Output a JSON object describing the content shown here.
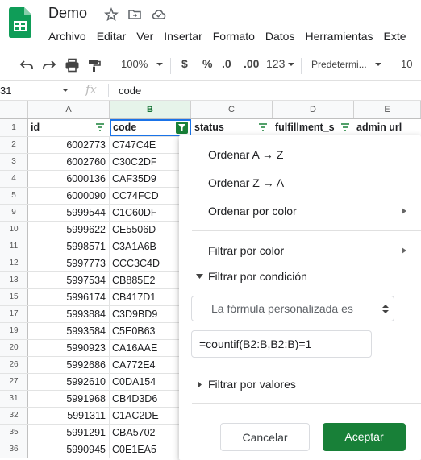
{
  "doc_title": "Demo",
  "menu": [
    "Archivo",
    "Editar",
    "Ver",
    "Insertar",
    "Formato",
    "Datos",
    "Herramientas",
    "Exte"
  ],
  "toolbar": {
    "zoom": "100%",
    "currency": "$",
    "percent": "%",
    "dec_less": ".0",
    "dec_more": ".00",
    "format_more": "123",
    "font": "Predetermi...",
    "font_size": "10"
  },
  "formula_bar": {
    "cell_ref": "31",
    "fx": "fx",
    "content": "code"
  },
  "columns": [
    "A",
    "B",
    "C",
    "D",
    "E"
  ],
  "header_row": {
    "row_number": "1",
    "cells": [
      "id",
      "code",
      "status",
      "fulfillment_s",
      "admin url"
    ]
  },
  "rows": [
    {
      "n": "2",
      "id": "6002773",
      "code": "C747C4E"
    },
    {
      "n": "3",
      "id": "6002760",
      "code": "C30C2DF"
    },
    {
      "n": "4",
      "id": "6000136",
      "code": "CAF35D9"
    },
    {
      "n": "5",
      "id": "6000090",
      "code": "CC74FCD"
    },
    {
      "n": "9",
      "id": "5999544",
      "code": "C1C60DF"
    },
    {
      "n": "10",
      "id": "5999622",
      "code": "CE5506D"
    },
    {
      "n": "11",
      "id": "5998571",
      "code": "C3A1A6B"
    },
    {
      "n": "12",
      "id": "5997773",
      "code": "CCC3C4D"
    },
    {
      "n": "13",
      "id": "5997534",
      "code": "CB885E2"
    },
    {
      "n": "15",
      "id": "5996174",
      "code": "CB417D1"
    },
    {
      "n": "17",
      "id": "5993884",
      "code": "C3D9BD9"
    },
    {
      "n": "19",
      "id": "5993584",
      "code": "C5E0B63"
    },
    {
      "n": "20",
      "id": "5990923",
      "code": "CA16AAE"
    },
    {
      "n": "26",
      "id": "5992686",
      "code": "CA772E4"
    },
    {
      "n": "27",
      "id": "5992610",
      "code": "C0DA154"
    },
    {
      "n": "31",
      "id": "5991968",
      "code": "CB4D3D6"
    },
    {
      "n": "32",
      "id": "5991311",
      "code": "C1AC2DE"
    },
    {
      "n": "35",
      "id": "5991291",
      "code": "CBA5702"
    },
    {
      "n": "36",
      "id": "5990945",
      "code": "C0E1EA5"
    }
  ],
  "filter_menu": {
    "sort_az": "Ordenar A → Z",
    "sort_za": "Ordenar Z → A",
    "sort_color": "Ordenar por color",
    "filter_color": "Filtrar por color",
    "filter_condition": "Filtrar por condición",
    "condition_select": "La fórmula personalizada es",
    "formula_value": "=countif(B2:B,B2:B)=1",
    "filter_values": "Filtrar por valores",
    "cancel": "Cancelar",
    "ok": "Aceptar"
  },
  "colors": {
    "accent_green": "#188038",
    "selected_col_header": "#e6f4ea",
    "logo_green": "#0f9d58"
  },
  "icons": [
    "sheets-logo",
    "star-icon",
    "move-folder-icon",
    "cloud-saved-icon",
    "undo-icon",
    "redo-icon",
    "print-icon",
    "paint-format-icon",
    "filter-icon",
    "chevron-down-icon",
    "expand-arrow-icon"
  ]
}
